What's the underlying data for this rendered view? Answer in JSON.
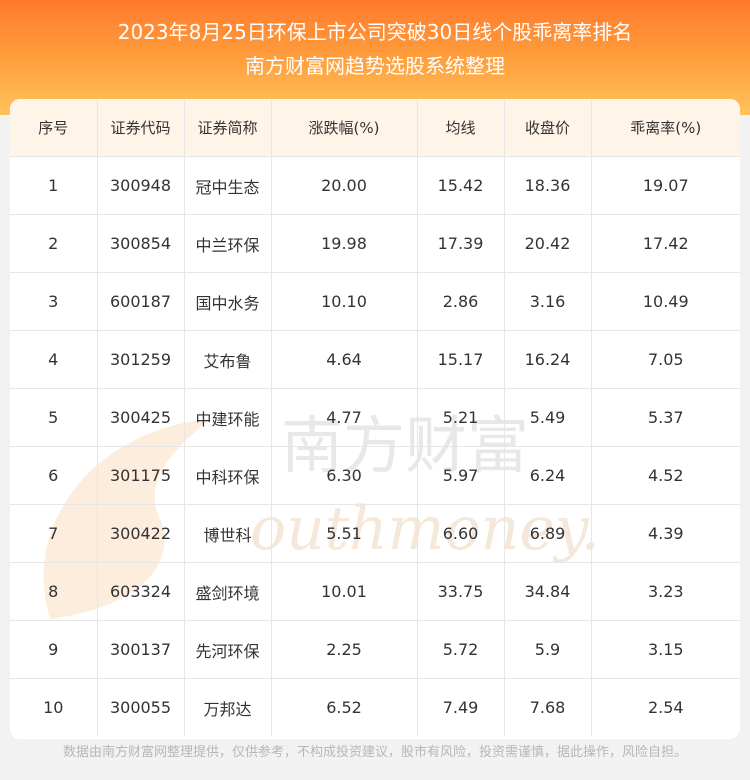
{
  "header": {
    "title": "2023年8月25日环保上市公司突破30日线个股乖离率排名",
    "subtitle": "南方财富网趋势选股系统整理"
  },
  "watermark": {
    "cn": "南方财富",
    "en": "outhmoney."
  },
  "table": {
    "columns": [
      "序号",
      "证券代码",
      "证券简称",
      "涨跌幅(%)",
      "均线",
      "收盘价",
      "乖离率(%)"
    ],
    "rows": [
      [
        "1",
        "300948",
        "冠中生态",
        "20.00",
        "15.42",
        "18.36",
        "19.07"
      ],
      [
        "2",
        "300854",
        "中兰环保",
        "19.98",
        "17.39",
        "20.42",
        "17.42"
      ],
      [
        "3",
        "600187",
        "国中水务",
        "10.10",
        "2.86",
        "3.16",
        "10.49"
      ],
      [
        "4",
        "301259",
        "艾布鲁",
        "4.64",
        "15.17",
        "16.24",
        "7.05"
      ],
      [
        "5",
        "300425",
        "中建环能",
        "4.77",
        "5.21",
        "5.49",
        "5.37"
      ],
      [
        "6",
        "301175",
        "中科环保",
        "6.30",
        "5.97",
        "6.24",
        "4.52"
      ],
      [
        "7",
        "300422",
        "博世科",
        "5.51",
        "6.60",
        "6.89",
        "4.39"
      ],
      [
        "8",
        "603324",
        "盛剑环境",
        "10.01",
        "33.75",
        "34.84",
        "3.23"
      ],
      [
        "9",
        "300137",
        "先河环保",
        "2.25",
        "5.72",
        "5.9",
        "3.15"
      ],
      [
        "10",
        "300055",
        "万邦达",
        "6.52",
        "7.49",
        "7.68",
        "2.54"
      ]
    ]
  },
  "footer": {
    "disclaimer": "数据由南方财富网整理提供，仅供参考，不构成投资建议，股市有风险，投资需谨慎，据此操作，风险自担。"
  }
}
